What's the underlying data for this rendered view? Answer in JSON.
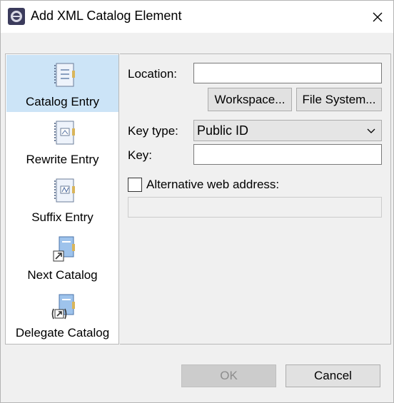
{
  "window": {
    "title": "Add XML Catalog Element",
    "app_icon": "eclipse-gear-icon",
    "close_icon": "close-icon"
  },
  "sidebar": {
    "items": [
      {
        "label": "Catalog Entry",
        "icon": "catalog-entry-icon",
        "selected": true
      },
      {
        "label": "Rewrite Entry",
        "icon": "rewrite-entry-icon",
        "selected": false
      },
      {
        "label": "Suffix Entry",
        "icon": "suffix-entry-icon",
        "selected": false
      },
      {
        "label": "Next Catalog",
        "icon": "next-catalog-icon",
        "selected": false
      },
      {
        "label": "Delegate Catalog",
        "icon": "delegate-catalog-icon",
        "selected": false
      }
    ],
    "selected_bg": "#cce4f7"
  },
  "form": {
    "location_label": "Location:",
    "location_value": "",
    "workspace_button": "Workspace...",
    "filesystem_button": "File System...",
    "key_type_label": "Key type:",
    "key_type_value": "Public ID",
    "key_label": "Key:",
    "key_value": "",
    "alt_web_label": "Alternative web address:",
    "alt_web_checked": false,
    "alt_web_value": ""
  },
  "footer": {
    "ok_label": "OK",
    "ok_enabled": false,
    "cancel_label": "Cancel"
  }
}
